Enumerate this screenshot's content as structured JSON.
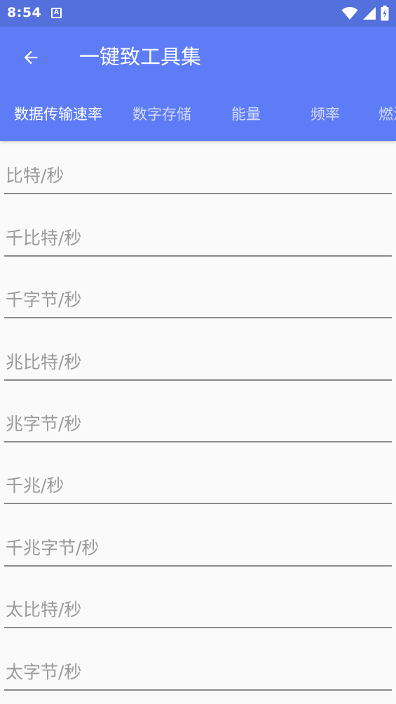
{
  "status_bar": {
    "time": "8:54",
    "notification_icon": "A",
    "icons": [
      "wifi-icon",
      "cellular-signal-icon",
      "battery-charging-icon"
    ]
  },
  "app_bar": {
    "title": "一键致工具集",
    "back_icon": "arrow-left-icon"
  },
  "colors": {
    "status_bar": "#5470dc",
    "app_bar": "#5e7cf6",
    "background": "#fafafa",
    "label": "#9a9a9a",
    "underline": "#8a8a8a"
  },
  "tabs": [
    {
      "label": "数据传输速率",
      "active": true
    },
    {
      "label": "数字存储",
      "active": false
    },
    {
      "label": "能量",
      "active": false
    },
    {
      "label": "频率",
      "active": false
    },
    {
      "label": "燃油",
      "active": false
    }
  ],
  "fields": [
    {
      "placeholder": "比特/秒"
    },
    {
      "placeholder": "千比特/秒"
    },
    {
      "placeholder": "千字节/秒"
    },
    {
      "placeholder": "兆比特/秒"
    },
    {
      "placeholder": "兆字节/秒"
    },
    {
      "placeholder": "千兆/秒"
    },
    {
      "placeholder": "千兆字节/秒"
    },
    {
      "placeholder": "太比特/秒"
    },
    {
      "placeholder": "太字节/秒"
    }
  ]
}
